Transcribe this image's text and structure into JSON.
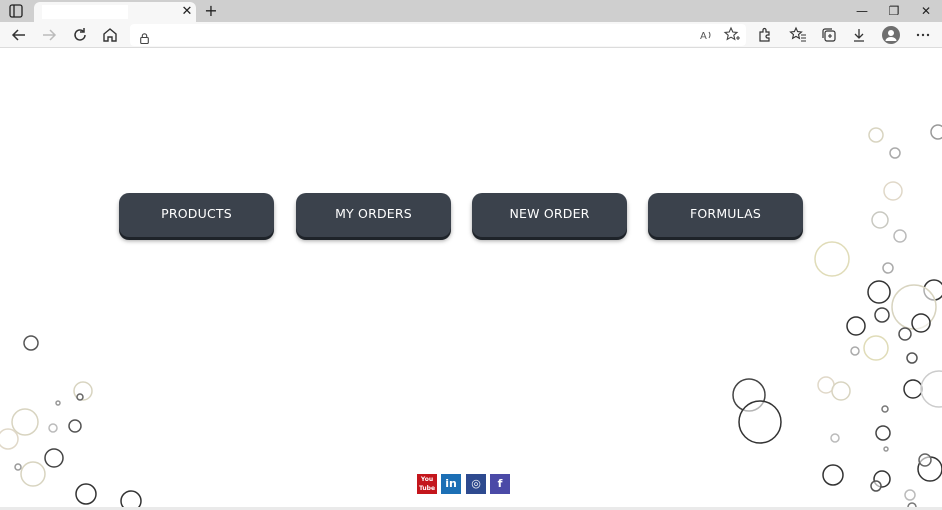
{
  "browser": {
    "tab_title": "",
    "tab_close": "✕",
    "new_tab": "+",
    "minimize": "—",
    "restore": "❐",
    "close": "✕"
  },
  "nav": {
    "buttons": [
      {
        "label": "PRODUCTS"
      },
      {
        "label": "MY ORDERS"
      },
      {
        "label": "NEW ORDER"
      },
      {
        "label": "FORMULAS"
      }
    ]
  },
  "social": {
    "youtube": {
      "label": "You Tube",
      "color": "#c4161c"
    },
    "linkedin": {
      "label": "in",
      "color": "#1c6fb5"
    },
    "instagram": {
      "label": "◎",
      "color": "#2e4a8f"
    },
    "facebook": {
      "label": "f",
      "color": "#4b4aa7"
    }
  }
}
